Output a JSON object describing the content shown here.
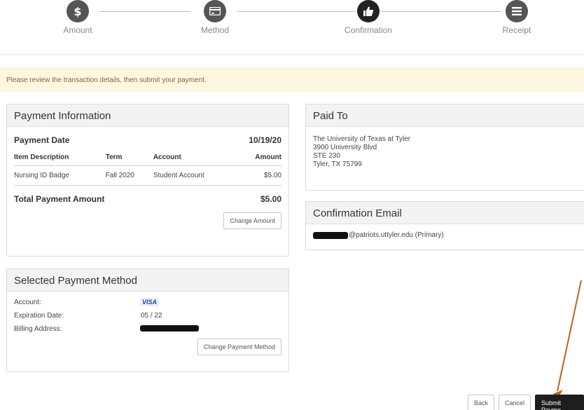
{
  "steps": [
    {
      "label": "Amount",
      "icon": "dollar-icon"
    },
    {
      "label": "Method",
      "icon": "card-icon"
    },
    {
      "label": "Confirmation",
      "icon": "thumbs-up-icon"
    },
    {
      "label": "Receipt",
      "icon": "list-icon"
    }
  ],
  "notice": "Please review the transaction details, then submit your payment.",
  "payment_info": {
    "title": "Payment Information",
    "date_label": "Payment Date",
    "date_value": "10/19/20",
    "columns": [
      "Item Description",
      "Term",
      "Account",
      "Amount"
    ],
    "rows": [
      [
        "Nursing ID Badge",
        "Fall 2020",
        "Student Account",
        "$5.00"
      ]
    ],
    "total_label": "Total Payment Amount",
    "total_value": "$5.00",
    "change_button": "Change Amount"
  },
  "paid_to": {
    "title": "Paid To",
    "lines": [
      "The University of Texas at Tyler",
      "3900 University Blvd",
      "STE 230",
      "Tyler, TX 75799"
    ]
  },
  "confirmation_email": {
    "title": "Confirmation Email",
    "email_suffix": "@patriots.uttyler.edu (Primary)"
  },
  "payment_method": {
    "title": "Selected Payment Method",
    "account_label": "Account:",
    "account_value": "VISA",
    "expiration_label": "Expiration Date:",
    "expiration_value": "05 / 22",
    "billing_label": "Billing Address:",
    "change_button": "Change Payment Method"
  },
  "actions": {
    "back": "Back",
    "cancel": "Cancel",
    "submit": "Submit Payme"
  },
  "colors": {
    "annotation_arrow": "#c0621e",
    "notice_bg": "#fdf6e0",
    "primary_button": "#1e1e1e"
  }
}
